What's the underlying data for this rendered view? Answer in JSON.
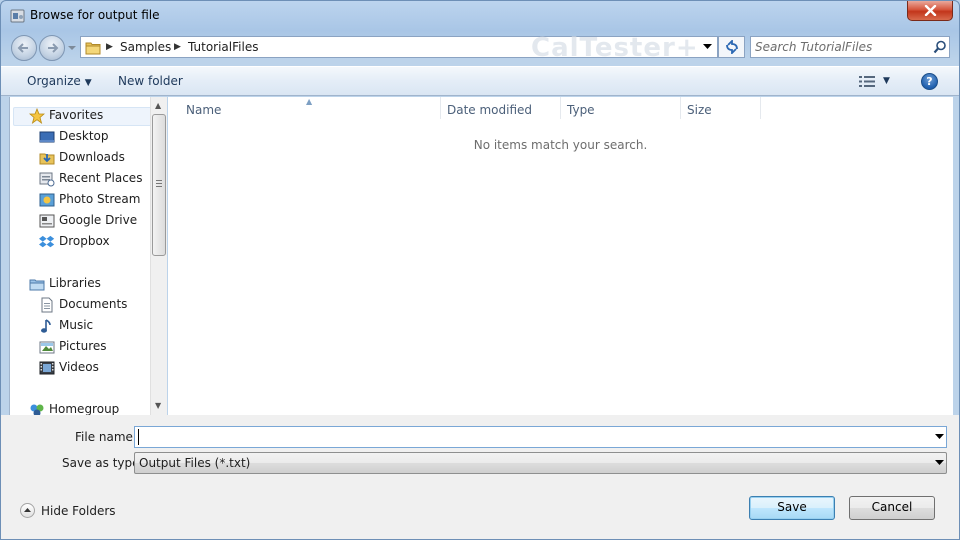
{
  "window": {
    "title": "Browse for output file"
  },
  "address": {
    "crumbs": [
      "Samples",
      "TutorialFiles"
    ],
    "watermark": "CalTester+"
  },
  "search": {
    "placeholder": "Search TutorialFiles"
  },
  "toolbar": {
    "organize_label": "Organize",
    "new_folder_label": "New folder",
    "help_label": "?"
  },
  "nav": {
    "favorites": "Favorites",
    "favorites_items": [
      "Desktop",
      "Downloads",
      "Recent Places",
      "Photo Stream",
      "Google Drive",
      "Dropbox"
    ],
    "libraries": "Libraries",
    "libraries_items": [
      "Documents",
      "Music",
      "Pictures",
      "Videos"
    ],
    "homegroup": "Homegroup"
  },
  "columns": [
    "Name",
    "Date modified",
    "Type",
    "Size"
  ],
  "content": {
    "empty_message": "No items match your search."
  },
  "form": {
    "file_name_label": "File name:",
    "file_name_value": "",
    "save_as_type_label": "Save as type:",
    "save_as_type_value": "Output Files (*.txt)"
  },
  "footer": {
    "hide_folders_label": "Hide Folders",
    "save_label": "Save",
    "cancel_label": "Cancel"
  },
  "colors": {
    "accent": "#3c7fb1",
    "frame": "#b9d1ea",
    "toolbar_text": "#1e395b"
  }
}
